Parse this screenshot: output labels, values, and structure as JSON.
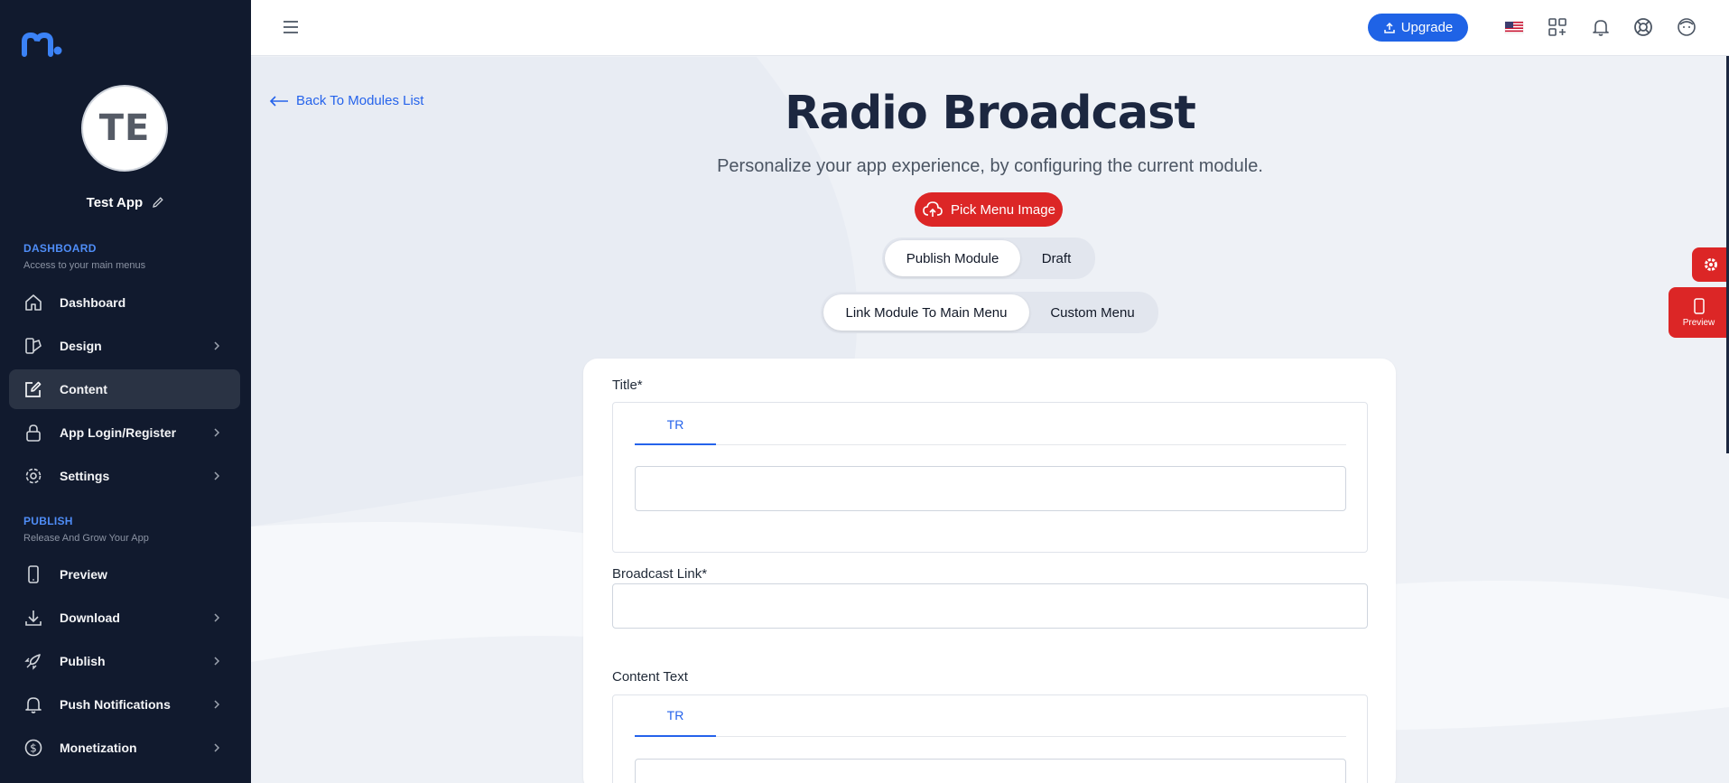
{
  "sidebar": {
    "app_avatar_initials": "TE",
    "app_name": "Test App",
    "dashboard_section": {
      "title": "DASHBOARD",
      "subtitle": "Access to your main menus"
    },
    "publish_section": {
      "title": "PUBLISH",
      "subtitle": "Release And Grow Your App"
    },
    "items": [
      {
        "label": "Dashboard",
        "icon": "home-icon",
        "has_chevron": false
      },
      {
        "label": "Design",
        "icon": "palette-icon",
        "has_chevron": true
      },
      {
        "label": "Content",
        "icon": "edit-icon",
        "has_chevron": false,
        "active": true
      },
      {
        "label": "App Login/Register",
        "icon": "lock-icon",
        "has_chevron": true
      },
      {
        "label": "Settings",
        "icon": "gear-icon",
        "has_chevron": true
      },
      {
        "label": "Preview",
        "icon": "phone-icon",
        "has_chevron": false
      },
      {
        "label": "Download",
        "icon": "download-icon",
        "has_chevron": true
      },
      {
        "label": "Publish",
        "icon": "rocket-icon",
        "has_chevron": true
      },
      {
        "label": "Push Notifications",
        "icon": "bell-icon",
        "has_chevron": true
      },
      {
        "label": "Monetization",
        "icon": "dollar-icon",
        "has_chevron": true
      }
    ]
  },
  "topbar": {
    "upgrade_label": "Upgrade",
    "icons": [
      "us-flag-icon",
      "apps-icon",
      "bell-icon",
      "support-icon",
      "user-avatar-icon"
    ]
  },
  "main": {
    "back_label": "Back To Modules List",
    "title": "Radio Broadcast",
    "subtitle": "Personalize your app experience, by configuring the current module.",
    "pick_image_label": "Pick Menu Image",
    "status_toggle": {
      "options": [
        "Publish Module",
        "Draft"
      ],
      "selected": "Publish Module"
    },
    "menu_toggle": {
      "options": [
        "Link Module To Main Menu",
        "Custom Menu"
      ],
      "selected": "Link Module To Main Menu"
    },
    "form": {
      "title_label": "Title*",
      "title_tab": "TR",
      "title_value": "",
      "broadcast_label": "Broadcast Link*",
      "broadcast_value": "",
      "content_label": "Content Text",
      "content_tab": "TR",
      "content_value": ""
    }
  },
  "floating": {
    "preview_label": "Preview"
  },
  "colors": {
    "sidebar_bg": "#111a2e",
    "accent_blue": "#2563eb",
    "accent_red": "#dc2626"
  }
}
